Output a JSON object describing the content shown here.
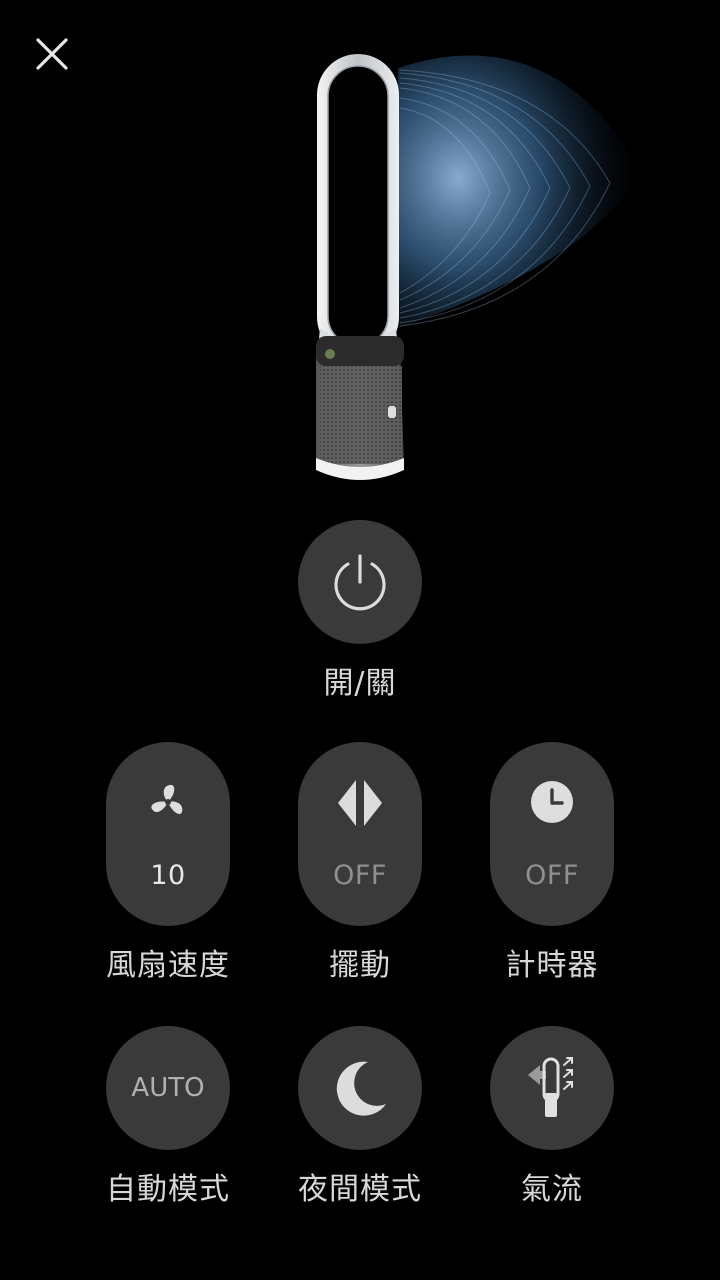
{
  "header": {
    "close_icon": "close-icon"
  },
  "hero": {
    "device_image": "fan-tower-with-airflow"
  },
  "power": {
    "label": "開/關",
    "icon": "power-icon"
  },
  "controls_row1": [
    {
      "id": "fan-speed",
      "label": "風扇速度",
      "value": "10",
      "icon": "fan-icon"
    },
    {
      "id": "oscillation",
      "label": "擺動",
      "value": "OFF",
      "icon": "oscillation-icon"
    },
    {
      "id": "timer",
      "label": "計時器",
      "value": "OFF",
      "icon": "clock-icon"
    }
  ],
  "controls_row2": [
    {
      "id": "auto-mode",
      "label": "自動模式",
      "value": "AUTO"
    },
    {
      "id": "night-mode",
      "label": "夜間模式",
      "icon": "moon-icon"
    },
    {
      "id": "airflow",
      "label": "氣流",
      "icon": "airflow-direction-icon"
    }
  ],
  "colors": {
    "background": "#000000",
    "button": "#3a3a3a",
    "icon": "#dcdcdc",
    "label": "#d8d8d8",
    "airflow": "#5f9fd8"
  }
}
